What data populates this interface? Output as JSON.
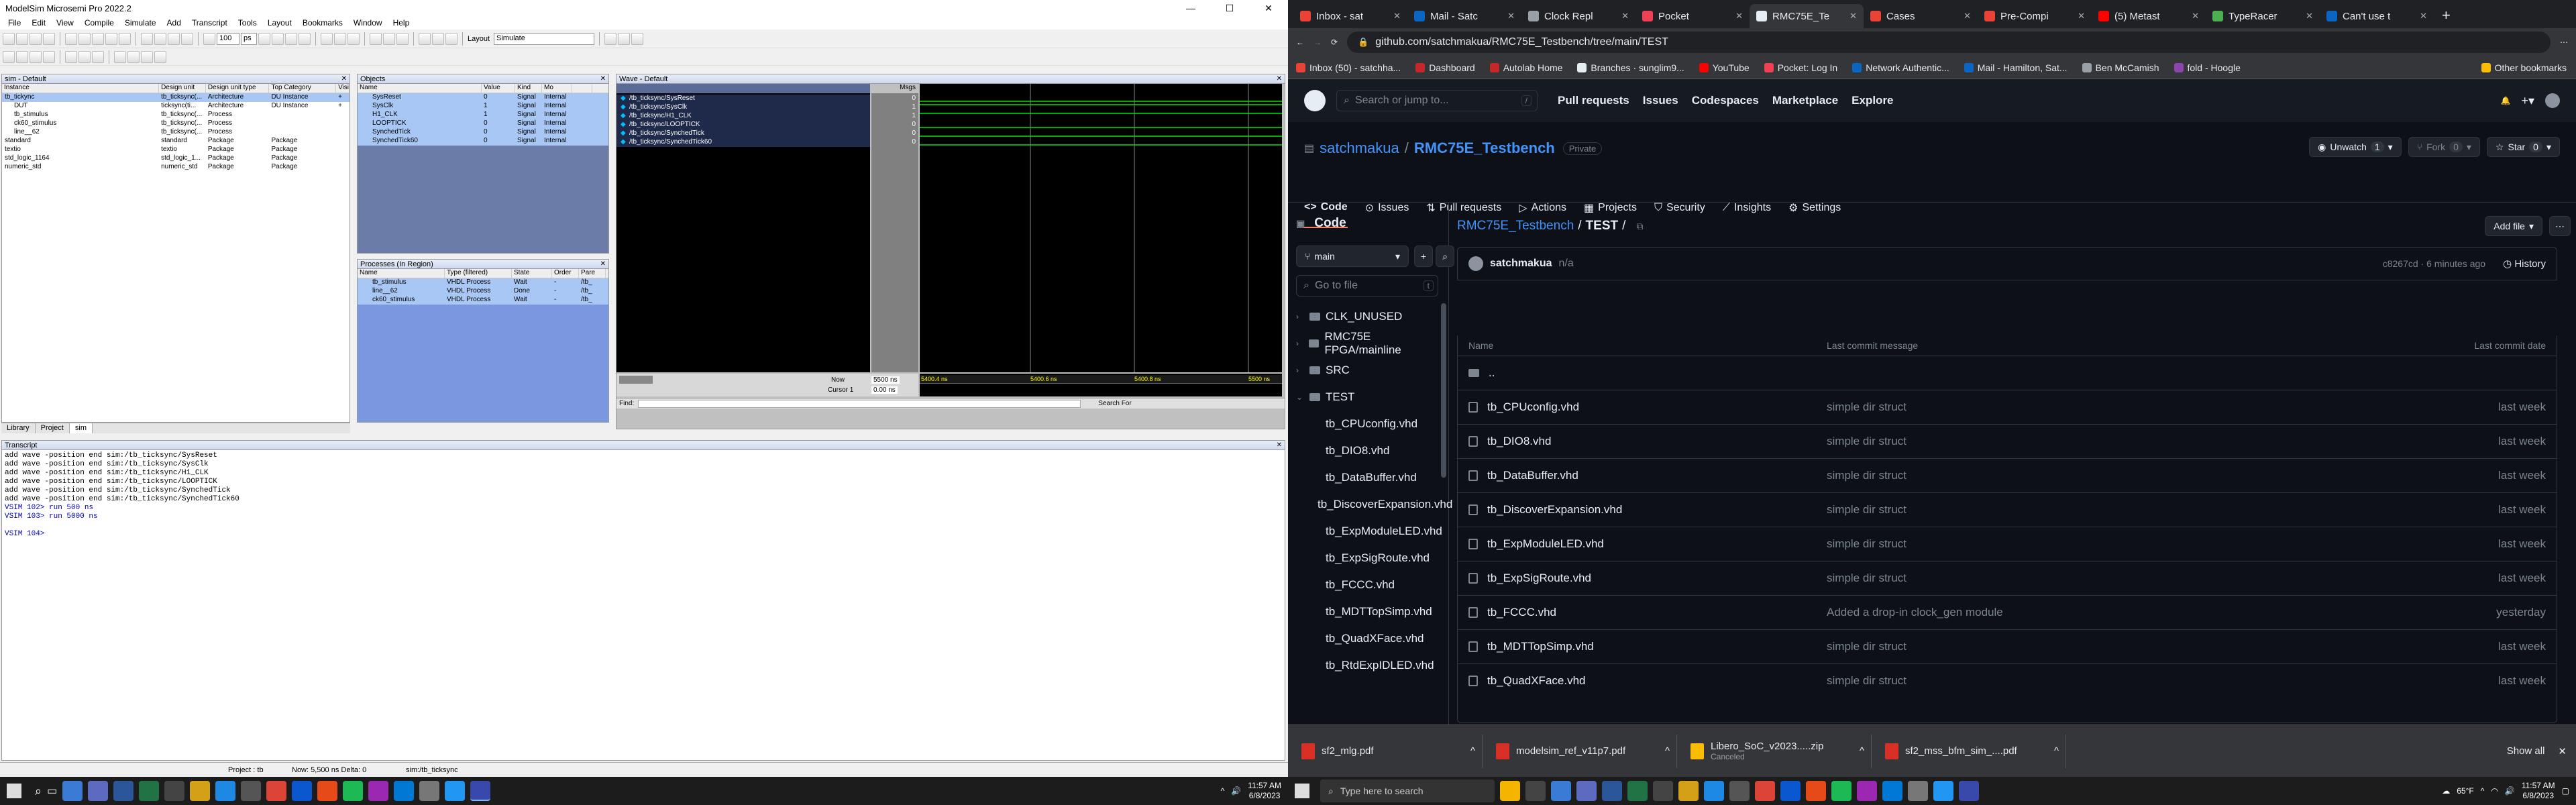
{
  "modelsim": {
    "title": "ModelSim Microsemi Pro 2022.2",
    "window_controls": [
      "—",
      "☐",
      "✕"
    ],
    "menu": [
      "File",
      "Edit",
      "View",
      "Compile",
      "Simulate",
      "Add",
      "Transcript",
      "Tools",
      "Layout",
      "Bookmarks",
      "Window",
      "Help"
    ],
    "toolbar": {
      "zoom_value": "100",
      "unit": "ps",
      "layout_label": "Layout",
      "layout_value": "Simulate"
    },
    "sim_panel": {
      "title": "sim - Default",
      "columns": [
        "Instance",
        "Design unit",
        "Design unit type",
        "Top Category",
        "Visi"
      ],
      "rows": [
        {
          "c": [
            "tb_tickync",
            "tb_ticksync(...",
            "Architecture",
            "DU Instance",
            "+"
          ]
        },
        {
          "c": [
            "DUT",
            "ticksync(ti...",
            "Architecture",
            "DU Instance",
            "+"
          ]
        },
        {
          "c": [
            "tb_stimulus",
            "tb_ticksync(...",
            "Process",
            "",
            ""
          ]
        },
        {
          "c": [
            "ck60_stimulus",
            "tb_ticksync(...",
            "Process",
            "",
            ""
          ]
        },
        {
          "c": [
            "line__62",
            "tb_ticksync(...",
            "Process",
            "",
            ""
          ]
        },
        {
          "c": [
            "standard",
            "standard",
            "Package",
            "Package",
            ""
          ]
        },
        {
          "c": [
            "textio",
            "textio",
            "Package",
            "Package",
            ""
          ]
        },
        {
          "c": [
            "std_logic_1164",
            "std_logic_1...",
            "Package",
            "Package",
            ""
          ]
        },
        {
          "c": [
            "numeric_std",
            "numeric_std",
            "Package",
            "Package",
            ""
          ]
        }
      ]
    },
    "objects_panel": {
      "title": "Objects",
      "columns": [
        "Name",
        "Value",
        "Kind",
        "Mo",
        ""
      ],
      "rows": [
        {
          "c": [
            "SysReset",
            "0",
            "Signal",
            "Internal"
          ]
        },
        {
          "c": [
            "SysClk",
            "1",
            "Signal",
            "Internal"
          ]
        },
        {
          "c": [
            "H1_CLK",
            "1",
            "Signal",
            "Internal"
          ]
        },
        {
          "c": [
            "LOOPTICK",
            "0",
            "Signal",
            "Internal"
          ]
        },
        {
          "c": [
            "SynchedTick",
            "0",
            "Signal",
            "Internal"
          ]
        },
        {
          "c": [
            "SynchedTick60",
            "0",
            "Signal",
            "Internal"
          ]
        }
      ]
    },
    "processes_panel": {
      "title": "Processes (In Region)",
      "columns": [
        "Name",
        "Type (filtered)",
        "State",
        "Order",
        "Pare"
      ],
      "rows": [
        {
          "c": [
            "tb_stimulus",
            "VHDL Process",
            "Wait",
            "-",
            "/tb_"
          ]
        },
        {
          "c": [
            "line__62",
            "VHDL Process",
            "Done",
            "-",
            "/tb_"
          ]
        },
        {
          "c": [
            "ck60_stimulus",
            "VHDL Process",
            "Wait",
            "-",
            "/tb_"
          ]
        }
      ]
    },
    "wave_panel": {
      "title": "Wave - Default",
      "msgs_header": "Msgs",
      "signals": [
        {
          "name": "/tb_ticksync/SysReset",
          "value": "0"
        },
        {
          "name": "/tb_ticksync/SysClk",
          "value": "1"
        },
        {
          "name": "/tb_ticksync/H1_CLK",
          "value": "1"
        },
        {
          "name": "/tb_ticksync/LOOPTICK",
          "value": "0"
        },
        {
          "name": "/tb_ticksync/SynchedTick",
          "value": "0"
        },
        {
          "name": "/tb_ticksync/SynchedTick60",
          "value": "0"
        }
      ],
      "now_label": "Now",
      "now_value": "5500 ns",
      "cursor_label": "Cursor 1",
      "cursor_value": "0.00 ns",
      "time_ticks": [
        "5400.4 ns",
        "5400.6 ns",
        "5400.8 ns",
        "5500 ns"
      ],
      "find_label": "Find:",
      "search_label": "Search For"
    },
    "tabs": [
      "Library",
      "Project",
      "sim"
    ],
    "transcript": {
      "title": "Transcript",
      "lines": [
        "add wave -position end  sim:/tb_ticksync/SysReset",
        "add wave -position end  sim:/tb_ticksync/SysClk",
        "add wave -position end  sim:/tb_ticksync/H1_CLK",
        "add wave -position end  sim:/tb_ticksync/LOOPTICK",
        "add wave -position end  sim:/tb_ticksync/SynchedTick",
        "add wave -position end  sim:/tb_ticksync/SynchedTick60",
        "VSIM 102> run 500 ns",
        "VSIM 103> run 5000 ns",
        "",
        "VSIM 104> "
      ]
    },
    "status": {
      "project": "Project : tb",
      "now": "Now: 5,500 ns  Delta: 0",
      "path": "sim:/tb_ticksync"
    }
  },
  "chrome": {
    "tabs": [
      {
        "label": "Inbox - sat",
        "color": "#ea4335"
      },
      {
        "label": "Mail - Satc",
        "color": "#0a66c2"
      },
      {
        "label": "Clock Repl",
        "color": "#9aa0a6"
      },
      {
        "label": "Pocket",
        "color": "#ef4056"
      },
      {
        "label": "RMC75E_Te",
        "color": "#e6edf3"
      },
      {
        "label": "Cases",
        "color": "#ea4335"
      },
      {
        "label": "Pre-Compi",
        "color": "#ea4335"
      },
      {
        "label": "(5) Metast",
        "color": "#ff0000"
      },
      {
        "label": "TypeRacer",
        "color": "#4caf50"
      },
      {
        "label": "Can't use t",
        "color": "#0a66c2"
      }
    ],
    "url": "github.com/satchmakua/RMC75E_Testbench/tree/main/TEST",
    "bookmarks": [
      "Inbox (50) - satchha...",
      "Dashboard",
      "Autolab Home",
      "Branches · sunglim9...",
      "YouTube",
      "Pocket: Log In",
      "Network Authentic...",
      "Mail - Hamilton, Sat...",
      "Ben McCamish",
      "fold - Hoogle",
      "Other bookmarks"
    ],
    "bookmark_colors": [
      "#ea4335",
      "#c62828",
      "#c62828",
      "#e6edf3",
      "#ff0000",
      "#ef4056",
      "#0a66c2",
      "#0a66c2",
      "#9aa0a6",
      "#8e44ad",
      "#fbbc04"
    ]
  },
  "github": {
    "search_placeholder": "Search or jump to...",
    "nav": [
      "Pull requests",
      "Issues",
      "Codespaces",
      "Marketplace",
      "Explore"
    ],
    "owner": "satchmakua",
    "repo": "RMC75E_Testbench",
    "visibility": "Private",
    "unwatch": "Unwatch",
    "unwatch_count": "1",
    "fork": "Fork",
    "fork_count": "0",
    "star": "Star",
    "star_count": "0",
    "repo_tabs": [
      "Code",
      "Issues",
      "Pull requests",
      "Actions",
      "Projects",
      "Security",
      "Insights",
      "Settings"
    ],
    "sidebar": {
      "title": "Code",
      "branch": "main",
      "goto_placeholder": "Go to file",
      "goto_key": "t",
      "tree": [
        {
          "name": "CLK_UNUSED",
          "type": "folder",
          "indent": 0
        },
        {
          "name": "RMC75E FPGA/mainline",
          "type": "folder",
          "indent": 0
        },
        {
          "name": "SRC",
          "type": "folder",
          "indent": 0
        },
        {
          "name": "TEST",
          "type": "folder-open",
          "indent": 0
        },
        {
          "name": "tb_CPUconfig.vhd",
          "type": "file",
          "indent": 1
        },
        {
          "name": "tb_DIO8.vhd",
          "type": "file",
          "indent": 1
        },
        {
          "name": "tb_DataBuffer.vhd",
          "type": "file",
          "indent": 1
        },
        {
          "name": "tb_DiscoverExpansion.vhd",
          "type": "file",
          "indent": 1
        },
        {
          "name": "tb_ExpModuleLED.vhd",
          "type": "file",
          "indent": 1
        },
        {
          "name": "tb_ExpSigRoute.vhd",
          "type": "file",
          "indent": 1
        },
        {
          "name": "tb_FCCC.vhd",
          "type": "file",
          "indent": 1
        },
        {
          "name": "tb_MDTTopSimp.vhd",
          "type": "file",
          "indent": 1
        },
        {
          "name": "tb_QuadXFace.vhd",
          "type": "file",
          "indent": 1
        },
        {
          "name": "tb_RtdExpIDLED.vhd",
          "type": "file",
          "indent": 1
        }
      ]
    },
    "breadcrumb": {
      "repo": "RMC75E_Testbench",
      "folder": "TEST",
      "sep": "/"
    },
    "add_file": "Add file",
    "commit": {
      "author": "satchmakua",
      "message": "n/a",
      "sha": "c8267cd · 6 minutes ago",
      "history": "History"
    },
    "table": {
      "headers": [
        "Name",
        "Last commit message",
        "Last commit date"
      ],
      "parent": "..",
      "files": [
        {
          "name": "tb_CPUconfig.vhd",
          "msg": "simple dir struct",
          "date": "last week"
        },
        {
          "name": "tb_DIO8.vhd",
          "msg": "simple dir struct",
          "date": "last week"
        },
        {
          "name": "tb_DataBuffer.vhd",
          "msg": "simple dir struct",
          "date": "last week"
        },
        {
          "name": "tb_DiscoverExpansion.vhd",
          "msg": "simple dir struct",
          "date": "last week"
        },
        {
          "name": "tb_ExpModuleLED.vhd",
          "msg": "simple dir struct",
          "date": "last week"
        },
        {
          "name": "tb_ExpSigRoute.vhd",
          "msg": "simple dir struct",
          "date": "last week"
        },
        {
          "name": "tb_FCCC.vhd",
          "msg": "Added a drop-in clock_gen module",
          "date": "yesterday"
        },
        {
          "name": "tb_MDTTopSimp.vhd",
          "msg": "simple dir struct",
          "date": "last week"
        },
        {
          "name": "tb_QuadXFace.vhd",
          "msg": "simple dir struct",
          "date": "last week"
        }
      ]
    }
  },
  "downloads": {
    "items": [
      {
        "name": "sf2_mlg.pdf",
        "sub": "",
        "kind": "pdf"
      },
      {
        "name": "modelsim_ref_v11p7.pdf",
        "sub": "",
        "kind": "pdf"
      },
      {
        "name": "Libero_SoC_v2023.....zip",
        "sub": "Canceled",
        "kind": "zip"
      },
      {
        "name": "sf2_mss_bfm_sim_....pdf",
        "sub": "",
        "kind": "pdf"
      }
    ],
    "show_all": "Show all"
  },
  "taskbar": {
    "left_time": "11:57 AM",
    "left_date": "6/8/2023",
    "search": "Type here to search",
    "weather": "65°F",
    "right_time": "11:57 AM",
    "right_date": "6/8/2023"
  }
}
